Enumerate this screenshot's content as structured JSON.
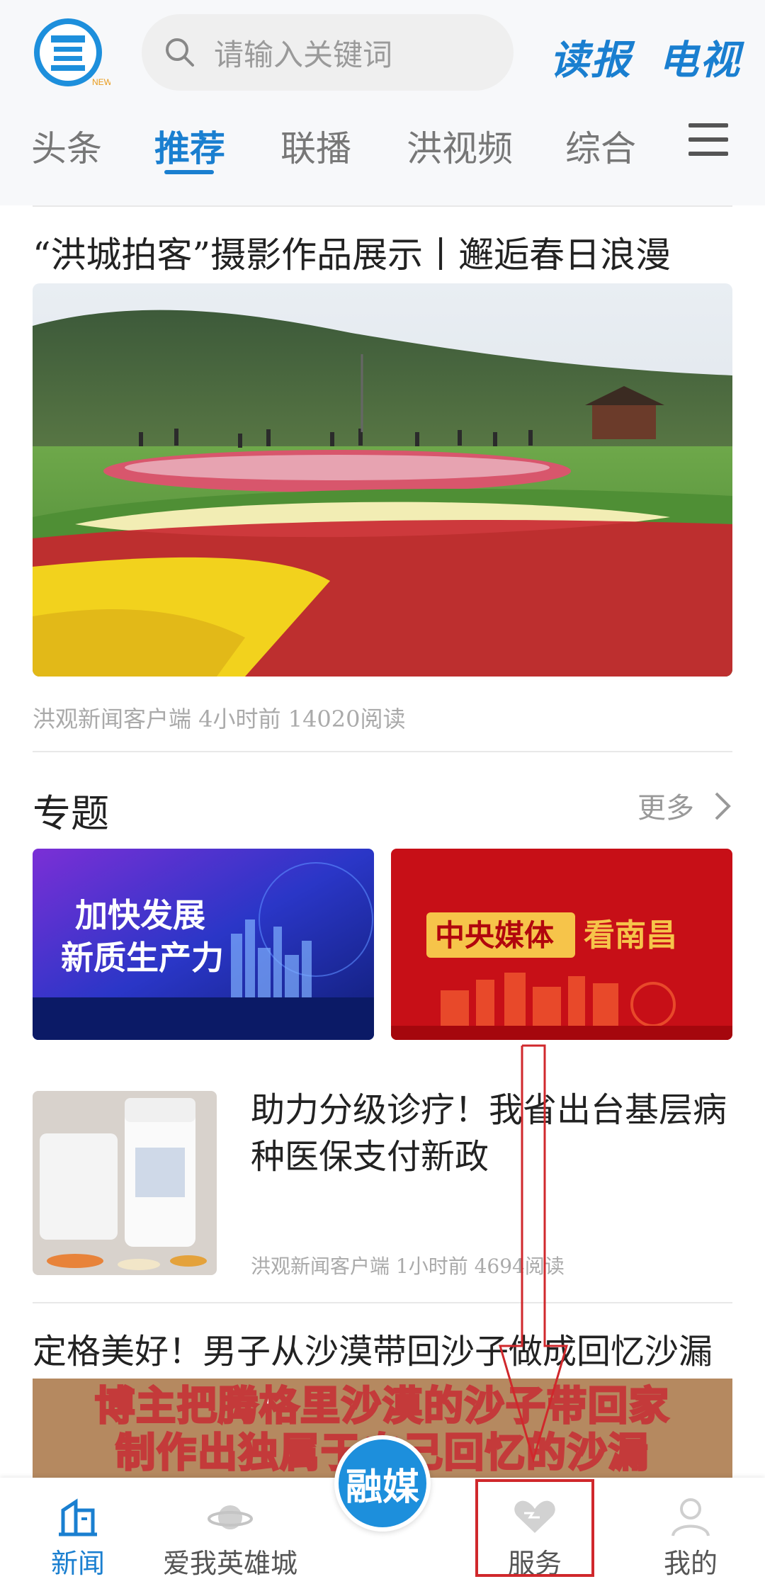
{
  "header": {
    "search_placeholder": "请输入关键词",
    "read_label": "读报",
    "tv_label": "电视",
    "logo_badge": "NEWS"
  },
  "tabs": [
    {
      "label": "头条"
    },
    {
      "label": "推荐",
      "active": true
    },
    {
      "label": "联播"
    },
    {
      "label": "洪视频"
    },
    {
      "label": "综合"
    }
  ],
  "feed": {
    "article1": {
      "title": "“洪城拍客”摄影作品展示丨邂逅春日浪漫",
      "meta": "洪观新闻客户端  4小时前  14020阅读"
    },
    "topics": {
      "title": "专题",
      "more_label": "更多",
      "items": [
        {
          "line1": "加快发展",
          "line2": "新质生产力"
        },
        {
          "prefix": "中央媒体",
          "suffix": "看南昌"
        }
      ]
    },
    "article2": {
      "title": "助力分级诊疗！我省出台基层病种医保支付新政",
      "meta": "洪观新闻客户端  1小时前  4694阅读"
    },
    "article3": {
      "title": "定格美好！男子从沙漠带回沙子做成回忆沙漏",
      "caption_line1": "博主把腾格里沙漠的沙子带回家",
      "caption_line2": "制作出独属于自己回忆的沙漏"
    }
  },
  "bottom_nav": {
    "items": [
      {
        "label": "新闻",
        "active": true
      },
      {
        "label": "爱我英雄城"
      },
      {
        "label": "服务"
      },
      {
        "label": "我的"
      }
    ],
    "center_label": "融媒"
  },
  "colors": {
    "accent": "#1a7fd0",
    "annotation": "#d0282c"
  }
}
